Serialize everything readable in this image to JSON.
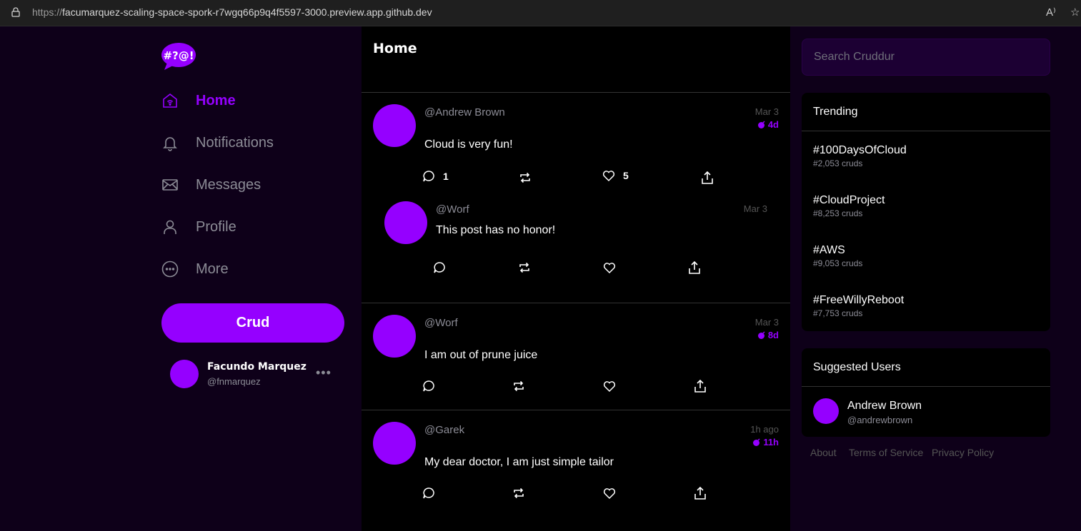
{
  "browser": {
    "url_scheme": "https://",
    "url_host": "facumarquez-scaling-space-spork-r7wgq66p9q4f5597-3000.preview.app.github.dev",
    "reader_icon": "A⁾",
    "favorite_icon": "☆"
  },
  "logo": {
    "text": "#?@!"
  },
  "nav": [
    {
      "label": "Home",
      "icon": "home-icon",
      "active": true
    },
    {
      "label": "Notifications",
      "icon": "bell-icon",
      "active": false
    },
    {
      "label": "Messages",
      "icon": "envelope-icon",
      "active": false
    },
    {
      "label": "Profile",
      "icon": "person-icon",
      "active": false
    },
    {
      "label": "More",
      "icon": "more-circle-icon",
      "active": false
    }
  ],
  "crud_button": "Crud",
  "profile": {
    "name": "Facundo Marquez",
    "handle": "@fnmarquez",
    "more": "•••"
  },
  "feed": {
    "title": "Home",
    "posts": [
      {
        "handle": "@Andrew Brown",
        "message": "Cloud is very fun!",
        "date": "Mar 3",
        "expires": "4d",
        "replies": "1",
        "likes": "5"
      },
      {
        "handle": "@Worf",
        "message": "This post has no honor!",
        "date": "Mar 3"
      },
      {
        "handle": "@Worf",
        "message": "I am out of prune juice",
        "date": "Mar 3",
        "expires": "8d"
      },
      {
        "handle": "@Garek",
        "message": "My dear doctor, I am just simple tailor",
        "date": "1h ago",
        "expires": "11h"
      }
    ]
  },
  "search": {
    "placeholder": "Search Cruddur"
  },
  "trending": {
    "title": "Trending",
    "items": [
      {
        "tag": "#100DaysOfCloud",
        "count": "#2,053 cruds"
      },
      {
        "tag": "#CloudProject",
        "count": "#8,253 cruds"
      },
      {
        "tag": "#AWS",
        "count": "#9,053 cruds"
      },
      {
        "tag": "#FreeWillyReboot",
        "count": "#7,753 cruds"
      }
    ]
  },
  "suggested": {
    "title": "Suggested Users",
    "users": [
      {
        "name": "Andrew Brown",
        "handle": "@andrewbrown"
      }
    ]
  },
  "footer": {
    "about": "About",
    "terms": "Terms of Service",
    "privacy": "Privacy Policy"
  },
  "colors": {
    "accent": "#9500ff",
    "sidebar_bg": "#0e0019",
    "main_bg": "#000000",
    "muted": "#8c8c96"
  }
}
